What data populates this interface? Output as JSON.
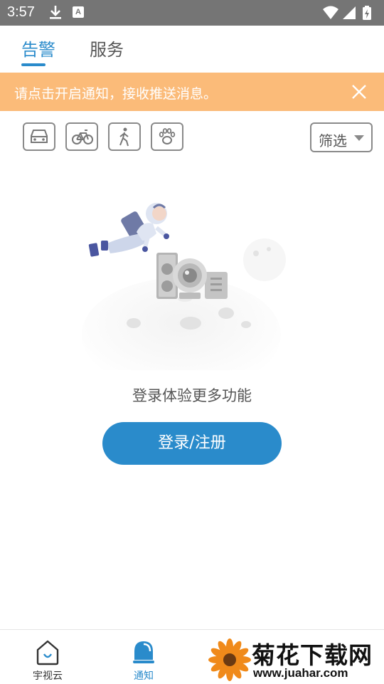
{
  "status_bar": {
    "time": "3:57",
    "notification_a": "A",
    "icons": [
      "download-icon",
      "a-notification-icon",
      "wifi-icon",
      "signal-icon",
      "battery-charging-icon"
    ]
  },
  "tabs": [
    {
      "label": "告警",
      "active": true
    },
    {
      "label": "服务",
      "active": false
    }
  ],
  "banner": {
    "text": "请点击开启通知，接收推送消息。",
    "color": "#fbbb79"
  },
  "filters": {
    "icons": [
      "car-icon",
      "bicycle-icon",
      "pedestrian-icon",
      "paw-icon"
    ],
    "select_label": "筛选"
  },
  "empty_state": {
    "text": "登录体验更多功能",
    "button": "登录/注册"
  },
  "bottom_nav": [
    {
      "label": "宇视云",
      "icon": "home-icon",
      "active": false
    },
    {
      "label": "通知",
      "icon": "bell-icon",
      "active": true
    }
  ],
  "watermark": {
    "title": "菊花下载网",
    "url": "www.juahar.com"
  },
  "colors": {
    "accent": "#2a8bcb",
    "status_bar": "#757575",
    "banner": "#fbbb79"
  }
}
